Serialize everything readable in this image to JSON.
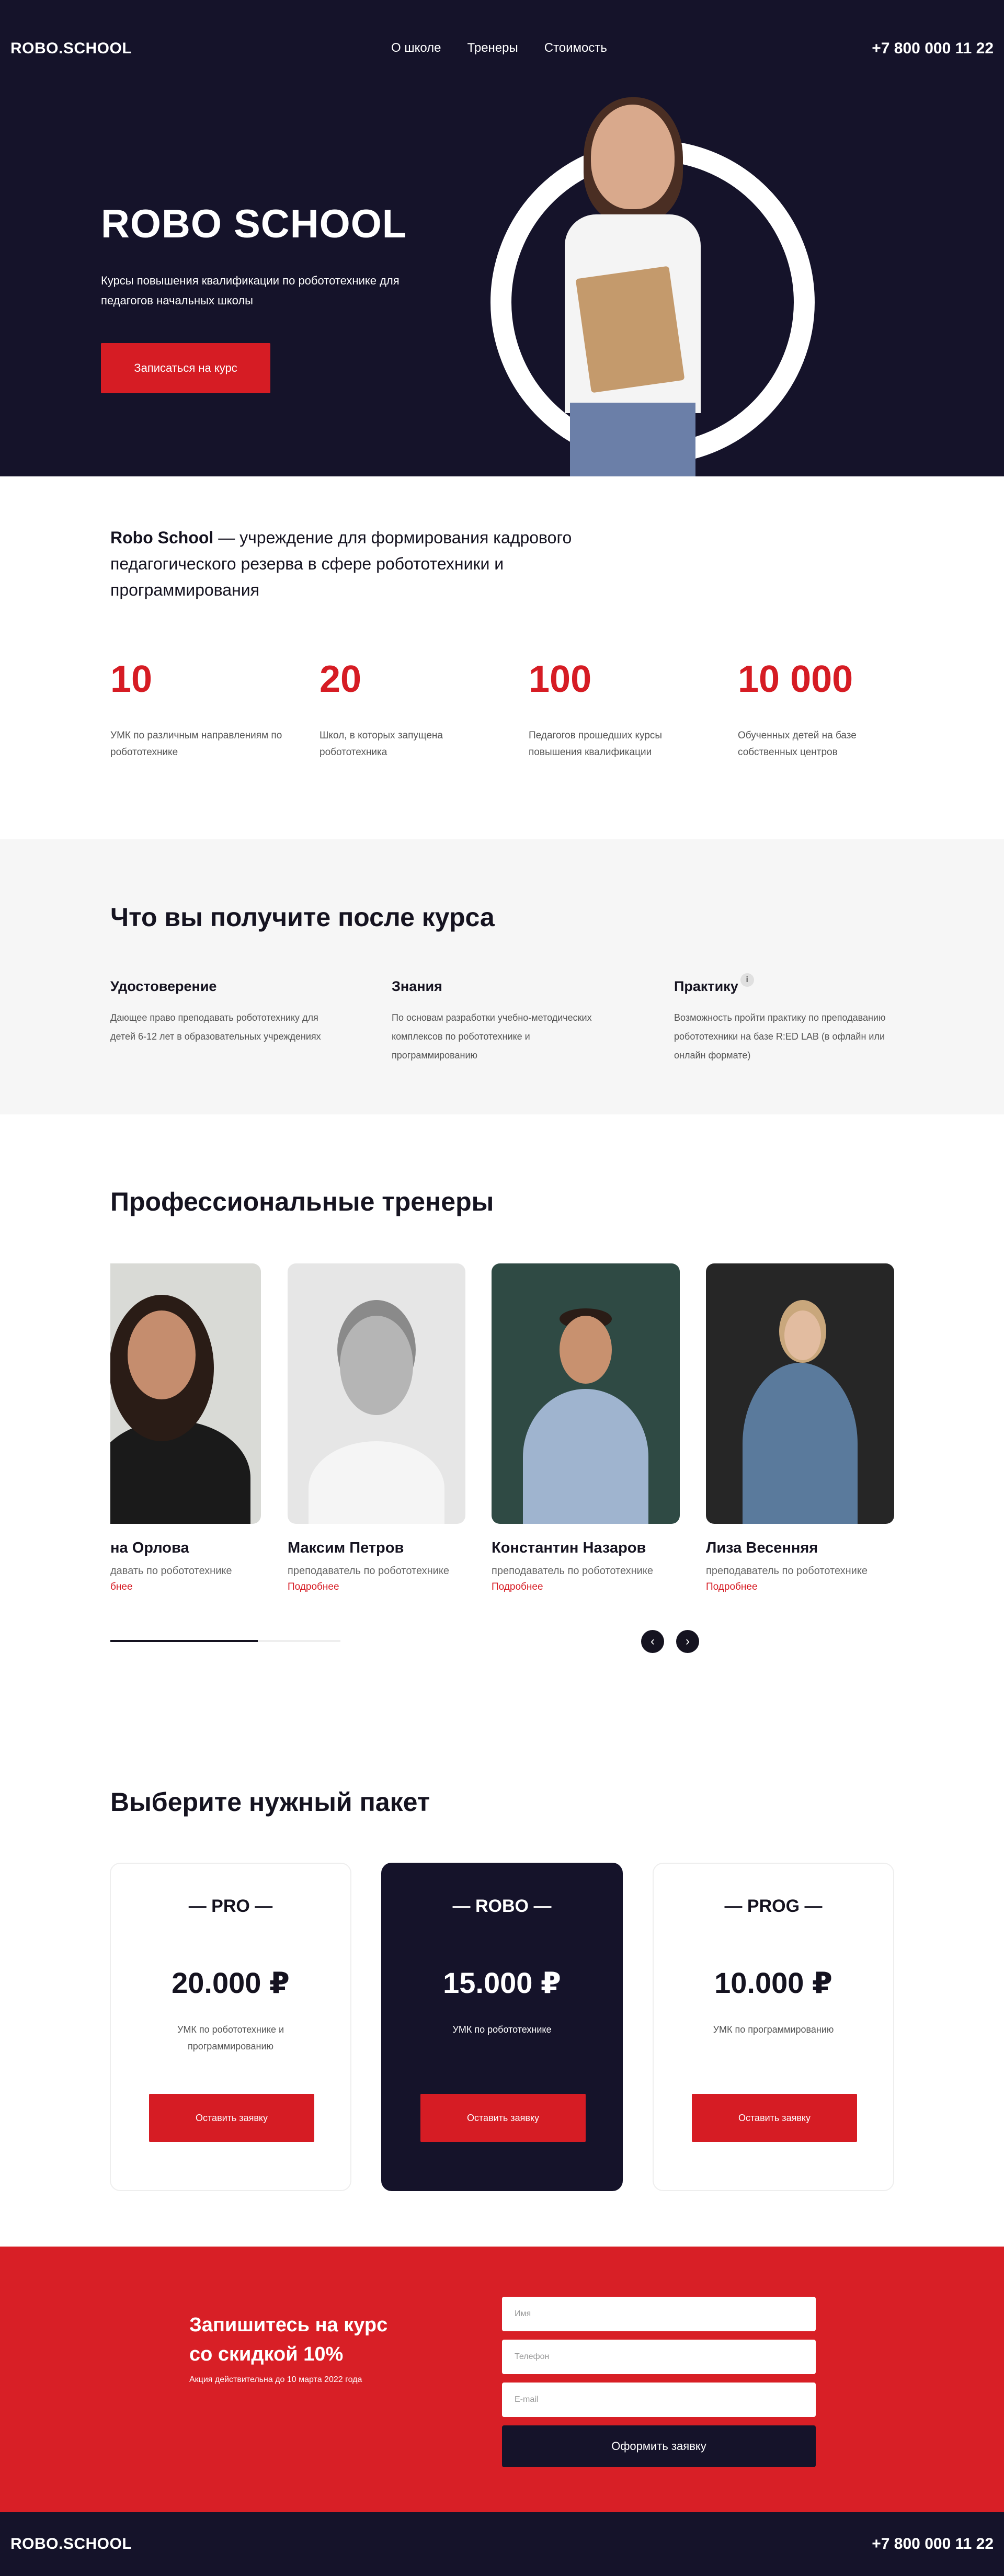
{
  "header": {
    "logo": "ROBO.SCHOOL",
    "menu": [
      "О школе",
      "Тренеры",
      "Стоимость"
    ],
    "phone": "+7 800 000 11 22"
  },
  "hero": {
    "title": "ROBO SCHOOL",
    "subtitle": "Курсы повышения квалификации по робототехнике для педагогов начальных школы",
    "cta": "Записаться на курс"
  },
  "about": {
    "brand": "Robo School",
    "text": " — учреждение для формирования кадрового педагогического резерва в сфере робототехники и программирования",
    "stats": [
      {
        "value": "10",
        "desc": "УМК по различным направлениям по робототехнике"
      },
      {
        "value": "20",
        "desc": "Школ, в которых запущена робототехника"
      },
      {
        "value": "100",
        "desc": "Педагогов прошедших курсы повышения квалификации"
      },
      {
        "value": "10 000",
        "desc": "Обученных детей на базе собственных центров"
      }
    ]
  },
  "benefits": {
    "title": "Что вы получите после курса",
    "items": [
      {
        "title": "Удостоверение",
        "text": "Дающее право преподавать робототехнику для детей 6-12 лет в образовательных учреждениях"
      },
      {
        "title": "Знания",
        "text": "По основам разработки учебно-методических комплексов по робототехнике и программированию"
      },
      {
        "title": "Практику",
        "text": "Возможность пройти практику по преподаванию робототехники на базе R:ED LAB (в офлайн или онлайн формате)"
      }
    ],
    "info_icon": "i"
  },
  "trainers": {
    "title": "Профессиональные тренеры",
    "items": [
      {
        "name": "на Орлова",
        "role": "давать по робототехнике",
        "more": "бнее"
      },
      {
        "name": "Максим Петров",
        "role": "преподаватель по робототехнике",
        "more": "Подробнее"
      },
      {
        "name": "Константин Назаров",
        "role": "преподаватель по робототехнике",
        "more": "Подробнее"
      },
      {
        "name": "Лиза Весенняя",
        "role": "преподаватель по робототехнике",
        "more": "Подробнее"
      }
    ],
    "progress": 0.64,
    "prev_icon": "‹",
    "next_icon": "›"
  },
  "pricing": {
    "title": "Выберите нужный пакет",
    "plans": [
      {
        "name": "— PRO —",
        "price": "20.000 ₽",
        "desc": "УМК по робототехнике и программированию",
        "button": "Оставить заявку"
      },
      {
        "name": "— ROBO —",
        "price": "15.000 ₽",
        "desc": "УМК по робототехнике",
        "button": "Оставить заявку"
      },
      {
        "name": "— PROG —",
        "price": "10.000 ₽",
        "desc": "УМК по программированию",
        "button": "Оставить заявку"
      }
    ]
  },
  "signup": {
    "title_line1": "Запишитесь на курс",
    "title_line2": "со скидкой 10%",
    "note": "Акция действительна до 10 марта 2022 года",
    "fields": [
      "Имя",
      "Телефон",
      "E-mail"
    ],
    "submit": "Оформить заявку"
  },
  "footer": {
    "logo": "ROBO.SCHOOL",
    "phone": "+7 800 000 11 22"
  },
  "colors": {
    "navy": "#15132a",
    "accent": "#d61c24"
  }
}
